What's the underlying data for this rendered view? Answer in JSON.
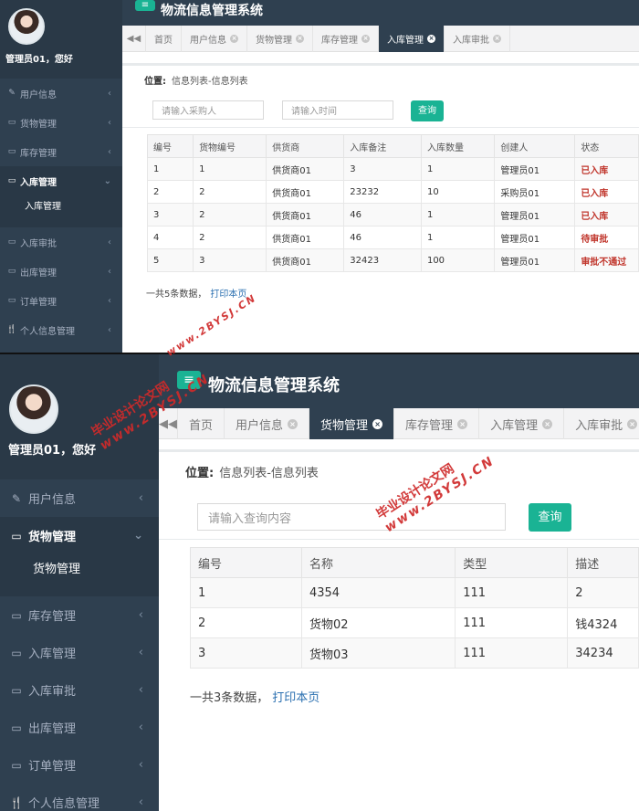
{
  "colors": {
    "sidebar": "#2f4050",
    "accent": "#1ab394",
    "status_red": "#c0352b",
    "watermark": "#cf2a2a"
  },
  "screens": [
    {
      "app_title": "物流信息管理系统",
      "greeting": "管理员01，您好",
      "menu": [
        {
          "label": "用户信息",
          "icon": "edit-icon"
        },
        {
          "label": "货物管理",
          "icon": "monitor-icon"
        },
        {
          "label": "库存管理",
          "icon": "monitor-icon"
        },
        {
          "label": "入库管理",
          "icon": "monitor-icon",
          "expanded": true,
          "sub": "入库管理"
        },
        {
          "label": "入库审批",
          "icon": "monitor-icon"
        },
        {
          "label": "出库管理",
          "icon": "monitor-icon"
        },
        {
          "label": "订单管理",
          "icon": "monitor-icon"
        },
        {
          "label": "个人信息管理",
          "icon": "utensils-icon"
        }
      ],
      "tabs": [
        {
          "label": "首页",
          "closable": false
        },
        {
          "label": "用户信息",
          "closable": true
        },
        {
          "label": "货物管理",
          "closable": true
        },
        {
          "label": "库存管理",
          "closable": true
        },
        {
          "label": "入库管理",
          "closable": true,
          "active": true
        },
        {
          "label": "入库审批",
          "closable": true
        }
      ],
      "breadcrumb_label": "位置:",
      "breadcrumb_path": "信息列表-信息列表",
      "inputs": [
        {
          "placeholder": "请输入采购人"
        },
        {
          "placeholder": "请输入时间"
        }
      ],
      "search_label": "查询",
      "table": {
        "headers": [
          "编号",
          "货物编号",
          "供货商",
          "入库备注",
          "入库数量",
          "创建人",
          "状态"
        ],
        "rows": [
          [
            "1",
            "1",
            "供货商01",
            "3",
            "1",
            "管理员01",
            "已入库"
          ],
          [
            "2",
            "2",
            "供货商01",
            "23232",
            "10",
            "采购员01",
            "已入库"
          ],
          [
            "3",
            "2",
            "供货商01",
            "46",
            "1",
            "管理员01",
            "已入库"
          ],
          [
            "4",
            "2",
            "供货商01",
            "46",
            "1",
            "管理员01",
            "待审批"
          ],
          [
            "5",
            "3",
            "供货商01",
            "32423",
            "100",
            "管理员01",
            "审批不通过"
          ]
        ]
      },
      "footer_count": "一共5条数据，",
      "footer_link": "打印本页"
    },
    {
      "app_title": "物流信息管理系统",
      "greeting": "管理员01，您好",
      "menu": [
        {
          "label": "用户信息",
          "icon": "edit-icon"
        },
        {
          "label": "货物管理",
          "icon": "monitor-icon",
          "expanded": true,
          "sub": "货物管理"
        },
        {
          "label": "库存管理",
          "icon": "monitor-icon"
        },
        {
          "label": "入库管理",
          "icon": "monitor-icon"
        },
        {
          "label": "入库审批",
          "icon": "monitor-icon"
        },
        {
          "label": "出库管理",
          "icon": "monitor-icon"
        },
        {
          "label": "订单管理",
          "icon": "monitor-icon"
        },
        {
          "label": "个人信息管理",
          "icon": "utensils-icon"
        }
      ],
      "tabs": [
        {
          "label": "首页",
          "closable": false
        },
        {
          "label": "用户信息",
          "closable": true
        },
        {
          "label": "货物管理",
          "closable": true,
          "active": true
        },
        {
          "label": "库存管理",
          "closable": true
        },
        {
          "label": "入库管理",
          "closable": true
        },
        {
          "label": "入库审批",
          "closable": true
        }
      ],
      "breadcrumb_label": "位置:",
      "breadcrumb_path": "信息列表-信息列表",
      "inputs": [
        {
          "placeholder": "请输入查询内容"
        }
      ],
      "search_label": "查询",
      "table": {
        "headers": [
          "编号",
          "名称",
          "类型",
          "描述"
        ],
        "rows": [
          [
            "1",
            "4354",
            "111",
            "2"
          ],
          [
            "2",
            "货物02",
            "111",
            "钱4324"
          ],
          [
            "3",
            "货物03",
            "111",
            "34234"
          ]
        ]
      },
      "footer_count": "一共3条数据，",
      "footer_link": "打印本页"
    }
  ],
  "watermark": {
    "line1": "毕业设计论文网",
    "line2": "www.2BYSJ.CN"
  }
}
